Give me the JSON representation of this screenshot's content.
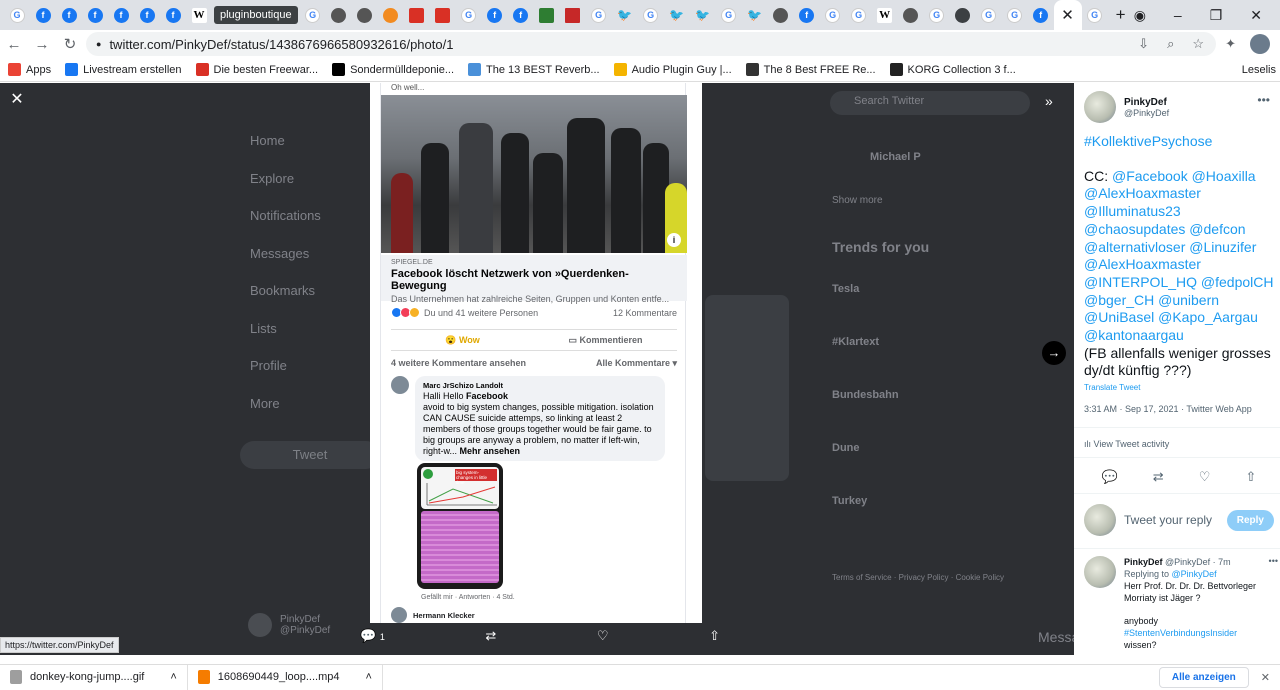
{
  "tabs": {
    "favicons": [
      "g",
      "fb",
      "fb",
      "fb",
      "fb",
      "fb",
      "fb",
      "w"
    ],
    "tooltip": "pluginboutique",
    "favicons2": [
      "g",
      "gr",
      "gr",
      "or",
      "rd",
      "rd",
      "g",
      "fb",
      "fb",
      "gn",
      "st",
      "g",
      "tw",
      "g",
      "tw",
      "tw",
      "g",
      "tw",
      "gr",
      "fb",
      "g",
      "g",
      "w",
      "gr",
      "g",
      "ch",
      "g",
      "g",
      "fb"
    ],
    "close_glyph": "✕",
    "new_tab_glyph": "+",
    "after_active": "g"
  },
  "toolbar": {
    "url": "twitter.com/PinkyDef/status/1438676966580932616/photo/1",
    "back": "←",
    "forward": "→",
    "reload": "↻",
    "lock": "🔒"
  },
  "bookmarks": [
    {
      "label": "Apps",
      "color": "#ea4335"
    },
    {
      "label": "Livestream erstellen",
      "color": "#1877f2"
    },
    {
      "label": "Die besten Freewar...",
      "color": "#d93025"
    },
    {
      "label": "Sondermülldeponie...",
      "color": "#000000"
    },
    {
      "label": "The 13 BEST Reverb...",
      "color": "#4a90d9"
    },
    {
      "label": "Audio Plugin Guy |...",
      "color": "#f4b400"
    },
    {
      "label": "The 8 Best FREE Re...",
      "color": "#333333"
    },
    {
      "label": "KORG Collection 3 f...",
      "color": "#222222"
    }
  ],
  "bookmarks_more": "Leselis",
  "photo": {
    "partial_text": "Oh well...",
    "card": {
      "source": "SPIEGEL.DE",
      "title": "Facebook löscht Netzwerk von »Querdenken-Bewegung",
      "subtitle": "Das Unternehmen hat zahlreiche Seiten, Gruppen und Konten entfe..."
    },
    "reactions": "Du und 41 weitere Personen",
    "comments_count": "12 Kommentare",
    "wow": "Wow",
    "comment_action": "Kommentieren",
    "more_comments": "4 weitere Kommentare ansehen",
    "all_comments": "Alle Kommentare ▾",
    "comment1": {
      "name": "Marc JrSchizo Landolt",
      "greeting_start": "Halli Hello ",
      "greeting_bold": "Facebook",
      "text": "avoid to big system changes, possible mitigation. isolation CAN CAUSE suicide attemps, so linking at least 2 members of those groups together would be fair game. to big groups are anyway a problem, no matter if left-win, right-w...",
      "more": " Mehr ansehen",
      "likes": "Gefällt mir · Antworten · 4 Std."
    },
    "phone_text": "big system-changes in little time",
    "comment2_name": "Hermann Klecker"
  },
  "photo_actions": {
    "reply_count": "1"
  },
  "sidebar": {
    "name": "PinkyDef",
    "handle": "@PinkyDef",
    "hashtag": "#KollektivePsychose",
    "cc_prefix": "CC: ",
    "mentions": "@Facebook @Hoaxilla @AlexHoaxmaster @Illuminatus23 @chaosupdates @defcon @alternativloser @Linuzifer @AlexHoaxmaster @INTERPOL_HQ @fedpolCH @bger_CH @unibern @UniBasel @Kapo_Aargau @kantonaargau",
    "closing": "(FB allenfalls weniger grosses dy/dt künftig ???)",
    "translate": "Translate Tweet",
    "meta": "3:31 AM · Sep 17, 2021 · Twitter Web App",
    "activity": "View Tweet activity",
    "reply_placeholder": "Tweet your reply",
    "reply_button": "Reply",
    "reply": {
      "name": "PinkyDef",
      "handle": "@PinkyDef · 7m",
      "replying_prefix": "Replying to ",
      "replying_to": "@PinkyDef",
      "text": "Herr Prof. Dr. Dr. Dr. Bettvorleger Morriaty ist Jäger ?",
      "text2": "anybody",
      "hashtag": "#StentenVerbindungsInsider",
      "cut": "wissen?"
    }
  },
  "background_page": {
    "nav": [
      "Home",
      "Explore",
      "Notifications",
      "Messages",
      "Bookmarks",
      "Lists",
      "Profile",
      "More"
    ],
    "tweet_btn": "Tweet",
    "trends_title": "Trends for you",
    "trends": [
      "Tesla",
      "#Klartext",
      "Bundesbahn",
      "Dune",
      "Turkey"
    ],
    "search": "Search Twitter",
    "who": "Michael P",
    "show_more": "Show more",
    "footer": "Terms of Service · Privacy Policy · Cookie Policy",
    "messages": "Messages",
    "bottom_name": "PinkyDef",
    "bottom_handle": "@PinkyDef"
  },
  "status_url": "https://twitter.com/PinkyDef",
  "downloads": [
    {
      "name": "donkey-kong-jump....gif",
      "color": "#9e9e9e"
    },
    {
      "name": "1608690449_loop....mp4",
      "color": "#f57c00"
    }
  ],
  "show_all": "Alle anzeigen"
}
